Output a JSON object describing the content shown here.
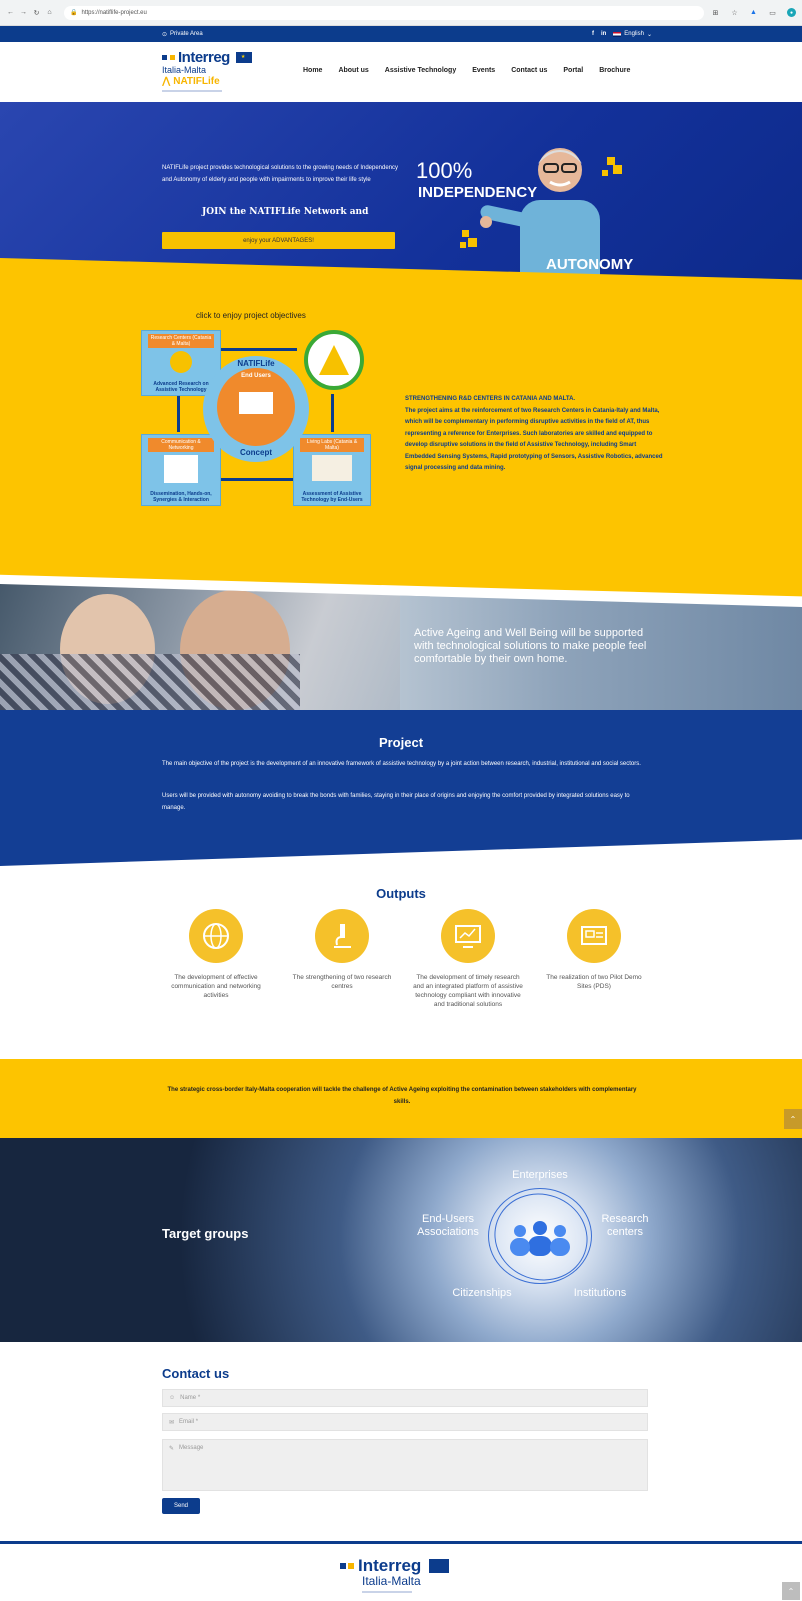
{
  "browser": {
    "url": "https://natiflife-project.eu"
  },
  "topbar": {
    "private_area": "Private Area",
    "language": "English"
  },
  "header": {
    "logo_line1": "Interreg",
    "logo_line2": "Italia-Malta",
    "logo_line3": "NATIFLife",
    "nav": [
      "Home",
      "About us",
      "Assistive Technology",
      "Events",
      "Contact us",
      "Portal",
      "Brochure"
    ]
  },
  "hero": {
    "text": "NATIFLife project provides technological solutions to the growing needs of Independency and Autonomy of elderly and people with impairments to improve their life style",
    "join": "JOIN the NATIFLife Network and",
    "button": "enjoy your ADVANTAGES!",
    "percent": "100%",
    "independency": "INDEPENDENCY",
    "autonomy": "AUTONOMY"
  },
  "objectives": {
    "click_label": "click to enjoy project objectives",
    "box_research_head": "Research Centers (Catania & Malta)",
    "box_research_foot": "Advanced Research on Assistive Technology",
    "box_comm_head": "Communication & Networking",
    "box_comm_foot": "Dissemination, Hands-on, Synergies & Interaction",
    "box_living_head": "Living Labs (Catania & Malta)",
    "box_living_foot": "Assessment of Assistive Technology by End-Users",
    "center_title": "NATIFLife",
    "center_sub": "End Users",
    "center_concept": "Concept",
    "heading": "STRENGTHENING R&D CENTERS IN CATANIA AND MALTA.",
    "body": "The project aims at the reinforcement of two Research Centers in Catania-Italy and Malta, which will be complementary in performing disruptive activities in the field of AT, thus representing a reference for Enterprises. Such laboratories are skilled and equipped to develop disruptive solutions in the field of Assistive Technology, including Smart Embedded Sensing Systems, Rapid prototyping of Sensors, Assistive Robotics, advanced signal processing and data mining."
  },
  "photo_band": {
    "text": "Active Ageing and Well Being will be supported with technological solutions to make people feel comfortable by their own home."
  },
  "project": {
    "title": "Project",
    "p1": "The main objective of the project is the development of an innovative framework of assistive technology by a joint action between research, industrial, institutional and social sectors.",
    "p2": "Users will be provided with autonomy avoiding to break the bonds with families, staying in their place of origins and enjoying the comfort provided by integrated solutions easy to manage."
  },
  "outputs": {
    "title": "Outputs",
    "items": [
      "The development of effective communication and networking activities",
      "The strengthening of two research centres",
      "The development of timely research and an integrated platform of assistive technology compliant with innovative and traditional solutions",
      "The realization of two Pilot Demo Sites (PDS)"
    ]
  },
  "strategic": {
    "text": "The strategic cross-border Italy-Malta cooperation will tackle the challenge of Active Ageing exploiting the contamination between stakeholders with complementary skills."
  },
  "target_groups": {
    "title": "Target groups",
    "enterprises": "Enterprises",
    "end_users": "End-Users Associations",
    "research": "Research centers",
    "citizenships": "Citizenships",
    "institutions": "Institutions"
  },
  "contact": {
    "title": "Contact us",
    "name_placeholder": "Name *",
    "email_placeholder": "Email *",
    "message_placeholder": "Message",
    "send": "Send"
  },
  "footer": {
    "logo_line1": "Interreg",
    "logo_line2": "Italia-Malta"
  },
  "colors": {
    "brand_blue": "#0c3c8c",
    "brand_yellow": "#fdc400"
  }
}
